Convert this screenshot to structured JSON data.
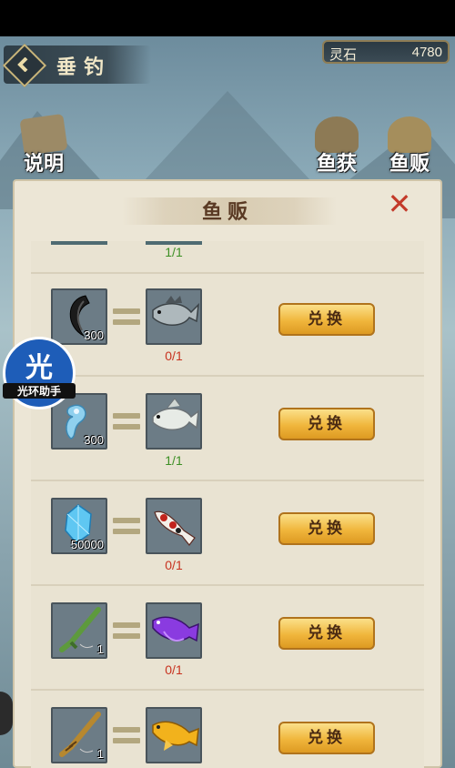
{
  "header": {
    "page_title": "垂钓",
    "currency_label": "灵石",
    "currency_value": "4780"
  },
  "top_icons": {
    "help": "说明",
    "catch": "鱼获",
    "seller": "鱼贩"
  },
  "dialog": {
    "title": "鱼贩",
    "close_symbol": "✕",
    "partial_row_progress": "1/1",
    "rows": [
      {
        "cost_item": "black-claw",
        "cost_qty": "300",
        "reward_item": "zander-fish",
        "progress": "0/1",
        "progress_state": "todo",
        "button": "兑换"
      },
      {
        "cost_item": "blue-jade-bead",
        "cost_qty": "300",
        "reward_item": "white-perch-fish",
        "progress": "1/1",
        "progress_state": "done",
        "button": "兑换"
      },
      {
        "cost_item": "blue-crystal",
        "cost_qty": "50000",
        "reward_item": "koi-fish",
        "progress": "0/1",
        "progress_state": "todo",
        "button": "兑换"
      },
      {
        "cost_item": "green-jade-fishing-rod",
        "cost_qty": "1",
        "reward_item": "purple-arowana-fish",
        "progress": "0/1",
        "progress_state": "todo",
        "button": "兑换"
      },
      {
        "cost_item": "golden-fishing-rod",
        "cost_qty": "1",
        "reward_item": "golden-arowana-fish",
        "progress": "",
        "progress_state": "done",
        "button": "兑换"
      }
    ]
  },
  "watermark": {
    "char": "光",
    "text": "光环助手"
  },
  "colors": {
    "accent_button": "#f0b63c",
    "progress_done": "#3c8f24",
    "progress_todo": "#c8321f",
    "close": "#c33a2a"
  }
}
